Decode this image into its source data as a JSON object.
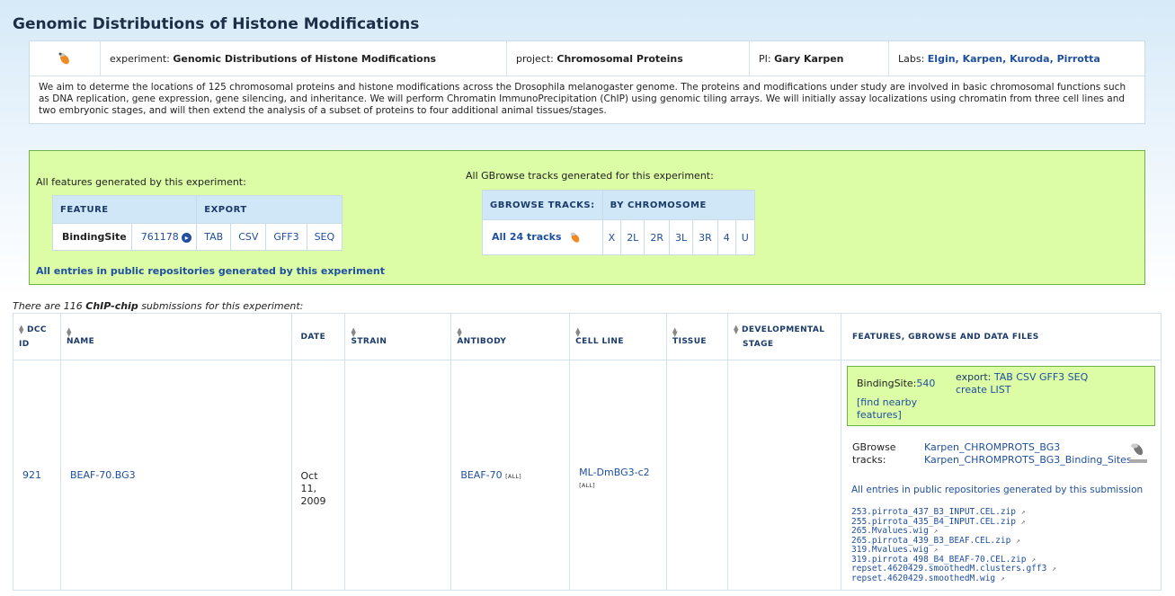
{
  "page_title": "Genomic Distributions of Histone Modifications",
  "info": {
    "experiment_label": "experiment:",
    "experiment_value": "Genomic Distributions of Histone Modifications",
    "project_label": "project:",
    "project_value": "Chromosomal Proteins",
    "pi_label": "PI:",
    "pi_value": "Gary Karpen",
    "labs_label": "Labs:",
    "labs": [
      "Elgin,",
      "Karpen,",
      "Kuroda,",
      "Pirrotta"
    ],
    "description": "We aim to determe the locations of 125 chromosomal proteins and histone modifications across the Drosophila melanogaster genome. The proteins and modifications under study are involved in basic chromosomal functions such as DNA replication, gene expression, gene silencing, and inheritance. We will perform Chromatin ImmunoPrecipitation (ChIP) using genomic tiling arrays. We will initially assay localizations using chromatin from three cell lines and two embryonic stages, and will then extend the analysis of a subset of proteins to four additional animal tissues/stages."
  },
  "features": {
    "heading": "All features generated by this experiment:",
    "col_feature": "FEATURE",
    "col_export": "EXPORT",
    "feature_name": "BindingSite",
    "feature_count": "761178",
    "exports": [
      "TAB",
      "CSV",
      "GFF3",
      "SEQ"
    ],
    "public_repo_link": "All entries in public repositories generated by this experiment"
  },
  "gbrowse": {
    "heading": "All GBrowse tracks generated for this experiment:",
    "col_tracks": "GBROWSE TRACKS:",
    "col_chrom": "BY CHROMOSOME",
    "all_tracks": "All 24 tracks",
    "chromosomes": [
      "X",
      "2L",
      "2R",
      "3L",
      "3R",
      "4",
      "U"
    ]
  },
  "submissions_note": {
    "prefix": "There are 116 ",
    "bold": "ChIP-chip",
    "suffix": " submissions for this experiment:"
  },
  "table": {
    "headers": {
      "dcc_1": "DCC",
      "dcc_2": "ID",
      "name": "NAME",
      "date": "DATE",
      "strain": "STRAIN",
      "antibody": "ANTIBODY",
      "cell_line": "CELL LINE",
      "tissue": "TISSUE",
      "stage_1": "DEVELOPMENTAL",
      "stage_2": "STAGE",
      "files": "FEATURES, GBROWSE AND DATA FILES"
    },
    "row": {
      "dcc_id": "921",
      "name": "BEAF-70.BG3",
      "date_1": "Oct",
      "date_2": "11,",
      "date_3": "2009",
      "antibody": "BEAF-70",
      "antibody_tag": "[ALL]",
      "cell_line": "ML-DmBG3-c2",
      "cell_line_tag": "[ALL]",
      "feature_label": "BindingSite:",
      "feature_count": "540",
      "export_label": "export:",
      "exports": [
        "TAB",
        "CSV",
        "GFF3",
        "SEQ"
      ],
      "create_list": "create LIST",
      "find_nearby_1": "[find nearby",
      "find_nearby_2": "features]",
      "gbrowse_label_1": "GBrowse",
      "gbrowse_label_2": "tracks:",
      "tracks": [
        "Karpen_CHROMPROTS_BG3",
        "Karpen_CHROMPROTS_BG3_Binding_Sites"
      ],
      "public_repo_link": "All entries in public repositories generated by this submission",
      "files": [
        "253.pirrota_437_B3_INPUT.CEL.zip",
        "255.pirrota_435_B4_INPUT.CEL.zip",
        "265.Mvalues.wig",
        "265.pirrota_439_B3_BEAF.CEL.zip",
        "319.Mvalues.wig",
        "319.pirrota_498_B4_BEAF-70.CEL.zip",
        "repset.4620429.smoothedM.clusters.gff3",
        "repset.4620429.smoothedM.wig"
      ]
    }
  },
  "colors": {
    "heading": "#1b2f46",
    "link": "#1f4fa0",
    "green_panel": "#dcfca5",
    "green_border": "#6fb34a",
    "table_header": "#cfe7f6"
  }
}
